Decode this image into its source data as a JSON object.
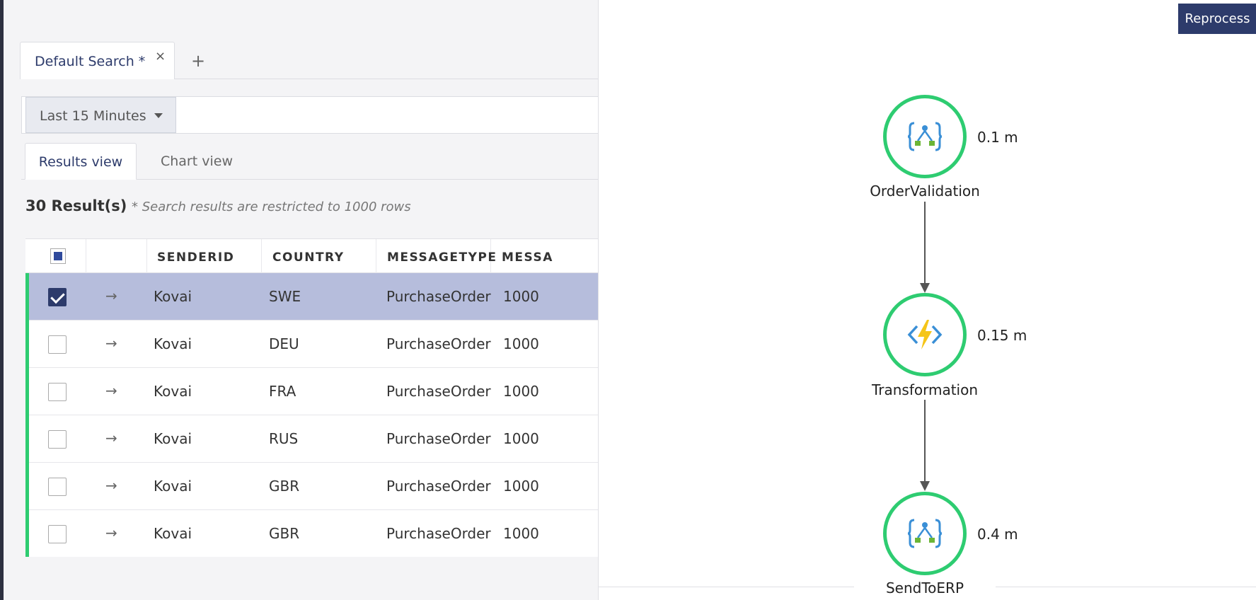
{
  "search_tabs": {
    "active_label": "Default Search *",
    "close_icon": "×",
    "add_icon": "+"
  },
  "filter": {
    "time_range": "Last 15 Minutes"
  },
  "view_tabs": [
    {
      "label": "Results view",
      "active": true
    },
    {
      "label": "Chart view",
      "active": false
    }
  ],
  "results": {
    "count_label": "30 Result(s)",
    "note": "* Search results are restricted to 1000 rows"
  },
  "grid": {
    "columns": [
      "SENDERID",
      "COUNTRY",
      "MESSAGETYPE",
      "MESSA"
    ],
    "rows": [
      {
        "senderid": "Kovai",
        "country": "SWE",
        "messagetype": "PurchaseOrder",
        "messa": "1000",
        "checked": true
      },
      {
        "senderid": "Kovai",
        "country": "DEU",
        "messagetype": "PurchaseOrder",
        "messa": "1000",
        "checked": false
      },
      {
        "senderid": "Kovai",
        "country": "FRA",
        "messagetype": "PurchaseOrder",
        "messa": "1000",
        "checked": false
      },
      {
        "senderid": "Kovai",
        "country": "RUS",
        "messagetype": "PurchaseOrder",
        "messa": "1000",
        "checked": false
      },
      {
        "senderid": "Kovai",
        "country": "GBR",
        "messagetype": "PurchaseOrder",
        "messa": "1000",
        "checked": false
      },
      {
        "senderid": "Kovai",
        "country": "GBR",
        "messagetype": "PurchaseOrder",
        "messa": "1000",
        "checked": false
      }
    ]
  },
  "panel": {
    "reprocess_label": "Reprocess",
    "steps": [
      {
        "name": "OrderValidation",
        "duration": "0.1 m",
        "icon": "logic-app-icon"
      },
      {
        "name": "Transformation",
        "duration": "0.15 m",
        "icon": "azure-function-icon"
      },
      {
        "name": "SendToERP",
        "duration": "0.4 m",
        "icon": "logic-app-icon"
      }
    ]
  },
  "colors": {
    "accent": "#2d3b6b",
    "success": "#2ecc71",
    "selected_row": "#b6bddc"
  }
}
